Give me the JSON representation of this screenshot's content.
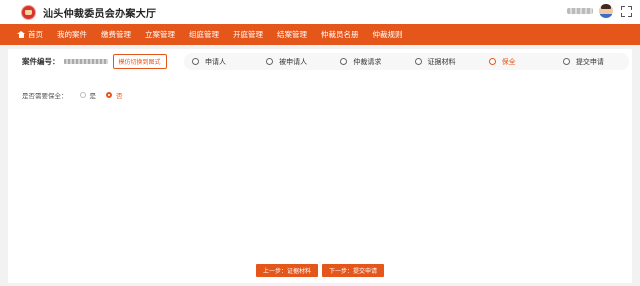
{
  "header": {
    "title": "汕头仲裁委员会办案大厅",
    "logo_icon": "emblem-logo-icon",
    "avatar_icon": "user-avatar-icon",
    "fullscreen_icon": "fullscreen-icon"
  },
  "nav": {
    "items": [
      {
        "label": "首页",
        "icon": "home-icon",
        "active": true
      },
      {
        "label": "我的案件"
      },
      {
        "label": "缴费管理"
      },
      {
        "label": "立案管理"
      },
      {
        "label": "组庭管理"
      },
      {
        "label": "开庭管理"
      },
      {
        "label": "结案管理"
      },
      {
        "label": "仲裁员名册"
      },
      {
        "label": "仲裁规则"
      }
    ]
  },
  "case_bar": {
    "case_no_label": "案件编号：",
    "switch_mode": "模仿切换到图式"
  },
  "steps": [
    {
      "label": "申请人"
    },
    {
      "label": "被申请人"
    },
    {
      "label": "仲裁请求"
    },
    {
      "label": "证据材料"
    },
    {
      "label": "保全",
      "current": true
    },
    {
      "label": "提交申请"
    }
  ],
  "form": {
    "question": "是否需要保全：",
    "options": [
      {
        "label": "是",
        "checked": false
      },
      {
        "label": "否",
        "checked": true
      }
    ]
  },
  "footer": {
    "prev_button": "上一步：证据材料",
    "next_button": "下一步：提交申请"
  },
  "colors": {
    "accent": "#e5561b",
    "background": "#f2f2f2"
  }
}
